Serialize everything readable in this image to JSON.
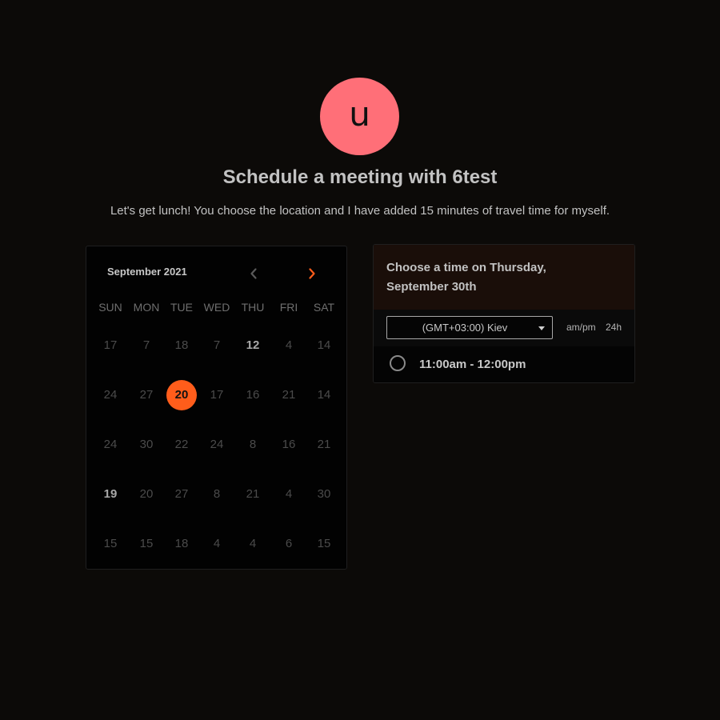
{
  "colors": {
    "accent": "#ff5d1b",
    "avatar_bg": "#ff6f78",
    "background": "#0c0a08"
  },
  "host": {
    "avatar_letter": "u",
    "title": "Schedule a meeting with 6test",
    "description": "Let's get lunch! You choose the location and I have added 15 minutes of travel time for myself."
  },
  "calendar": {
    "month_label": "September 2021",
    "prev_icon": "chevron-left-icon",
    "next_icon": "chevron-right-icon",
    "weekdays": [
      "SUN",
      "MON",
      "TUE",
      "WED",
      "THU",
      "FRI",
      "SAT"
    ],
    "weeks": [
      [
        {
          "label": "17",
          "state": "disabled"
        },
        {
          "label": "7",
          "state": "disabled"
        },
        {
          "label": "18",
          "state": "disabled"
        },
        {
          "label": "7",
          "state": "disabled"
        },
        {
          "label": "12",
          "state": "available"
        },
        {
          "label": "4",
          "state": "disabled"
        },
        {
          "label": "14",
          "state": "disabled"
        }
      ],
      [
        {
          "label": "24",
          "state": "disabled"
        },
        {
          "label": "27",
          "state": "disabled"
        },
        {
          "label": "20",
          "state": "selected"
        },
        {
          "label": "17",
          "state": "disabled"
        },
        {
          "label": "16",
          "state": "disabled"
        },
        {
          "label": "21",
          "state": "disabled"
        },
        {
          "label": "14",
          "state": "disabled"
        }
      ],
      [
        {
          "label": "24",
          "state": "disabled"
        },
        {
          "label": "30",
          "state": "disabled"
        },
        {
          "label": "22",
          "state": "disabled"
        },
        {
          "label": "24",
          "state": "disabled"
        },
        {
          "label": "8",
          "state": "disabled"
        },
        {
          "label": "16",
          "state": "disabled"
        },
        {
          "label": "21",
          "state": "disabled"
        }
      ],
      [
        {
          "label": "19",
          "state": "available"
        },
        {
          "label": "20",
          "state": "disabled"
        },
        {
          "label": "27",
          "state": "disabled"
        },
        {
          "label": "8",
          "state": "disabled"
        },
        {
          "label": "21",
          "state": "disabled"
        },
        {
          "label": "4",
          "state": "disabled"
        },
        {
          "label": "30",
          "state": "disabled"
        }
      ],
      [
        {
          "label": "15",
          "state": "disabled"
        },
        {
          "label": "15",
          "state": "disabled"
        },
        {
          "label": "18",
          "state": "disabled"
        },
        {
          "label": "4",
          "state": "disabled"
        },
        {
          "label": "4",
          "state": "disabled"
        },
        {
          "label": "6",
          "state": "disabled"
        },
        {
          "label": "15",
          "state": "disabled"
        }
      ]
    ]
  },
  "time_panel": {
    "heading": "Choose a time on Thursday, September 30th",
    "timezone": {
      "selected": "(GMT+03:00) Kiev",
      "caret_icon": "caret-down-icon"
    },
    "format_options": {
      "ampm_label": "am/pm",
      "h24_label": "24h"
    },
    "slots": [
      {
        "label": "11:00am - 12:00pm",
        "selected": false
      }
    ]
  }
}
